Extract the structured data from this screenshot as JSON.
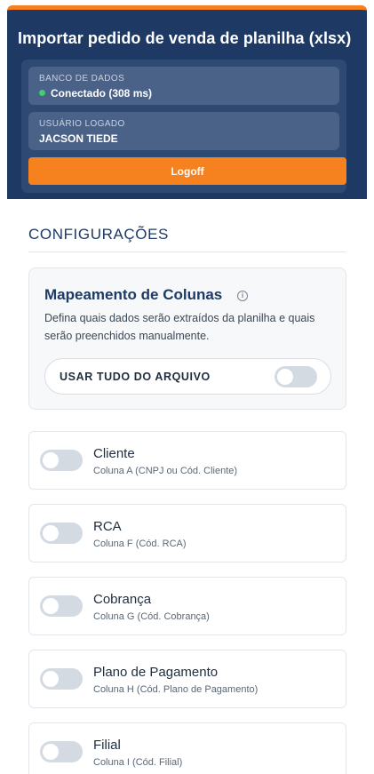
{
  "header": {
    "title": "Importar pedido de venda de planilha (xlsx)",
    "database": {
      "label": "BANCO DE DADOS",
      "status": "Conectado (308 ms)",
      "status_color": "#3ecf6e"
    },
    "user": {
      "label": "USUÁRIO LOGADO",
      "name": "JACSON TIEDE"
    },
    "logoff_label": "Logoff"
  },
  "config": {
    "section_title": "CONFIGURAÇÕES",
    "mapping": {
      "title": "Mapeamento de Colunas",
      "info_icon": "info-icon",
      "description": "Defina quais dados serão extraídos da planilha e quais serão preenchidos manualmente.",
      "use_all_label": "USAR TUDO DO ARQUIVO",
      "use_all_enabled": false
    },
    "fields": [
      {
        "name": "Cliente",
        "column": "Coluna A (CNPJ ou Cód. Cliente)",
        "enabled": false
      },
      {
        "name": "RCA",
        "column": "Coluna F (Cód. RCA)",
        "enabled": false
      },
      {
        "name": "Cobrança",
        "column": "Coluna G (Cód. Cobrança)",
        "enabled": false
      },
      {
        "name": "Plano de Pagamento",
        "column": "Coluna H (Cód. Plano de Pagamento)",
        "enabled": false
      },
      {
        "name": "Filial",
        "column": "Coluna I (Cód. Filial)",
        "enabled": false
      }
    ]
  },
  "colors": {
    "header_bg": "#1e3a64",
    "accent": "#f5821f",
    "toggle_off": "#d3dae2"
  }
}
